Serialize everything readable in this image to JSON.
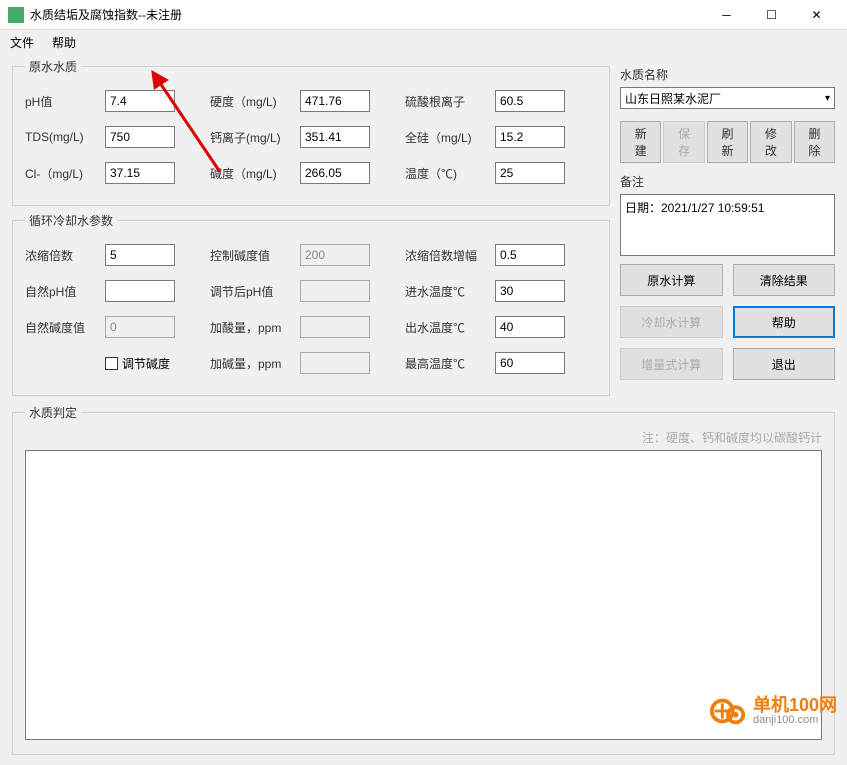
{
  "window": {
    "title": "水质结垢及腐蚀指数--未注册"
  },
  "menu": {
    "file": "文件",
    "help": "帮助"
  },
  "raw": {
    "legend": "原水水质",
    "ph_label": "pH值",
    "ph": "7.4",
    "tds_label": "TDS(mg/L)",
    "tds": "750",
    "cl_label": "Cl-（mg/L)",
    "cl": "37.15",
    "hardness_label": "硬度（mg/L)",
    "hardness": "471.76",
    "ca_label": "钙离子(mg/L)",
    "ca": "351.41",
    "alk_label": "碱度（mg/L)",
    "alk": "266.05",
    "so4_label": "硫酸根离子",
    "so4": "60.5",
    "si_label": "全硅（mg/L)",
    "si": "15.2",
    "temp_label": "温度（℃)",
    "temp": "25"
  },
  "cycle": {
    "legend": "循环冷却水参数",
    "conc_label": "浓缩倍数",
    "conc": "5",
    "natph_label": "自然pH值",
    "natph": "",
    "natalk_label": "自然碱度值",
    "natalk": "0",
    "adjust_check": "调节碱度",
    "ctrlalk_label": "控制碱度值",
    "ctrlalk": "200",
    "adjph_label": "调节后pH值",
    "adjph": "",
    "acid_label": "加酸量，ppm",
    "acid": "",
    "alkadd_label": "加碱量，ppm",
    "alkadd": "",
    "incr_label": "浓缩倍数增幅",
    "incr": "0.5",
    "tin_label": "进水温度℃",
    "tin": "30",
    "tout_label": "出水温度℃",
    "tout": "40",
    "tmax_label": "最高温度℃",
    "tmax": "60"
  },
  "right": {
    "name_label": "水质名称",
    "name_value": "山东日照某水泥厂",
    "btn_new": "新建",
    "btn_save": "保存",
    "btn_refresh": "刷新",
    "btn_modify": "修改",
    "btn_delete": "删除",
    "memo_label": "备注",
    "memo_text": "日期：2021/1/27 10:59:51",
    "btn_rawcalc": "原水计算",
    "btn_clear": "清除结果",
    "btn_coolcalc": "冷却水计算",
    "btn_help": "帮助",
    "btn_inccalc": "增量式计算",
    "btn_exit": "退出"
  },
  "judge": {
    "legend": "水质判定",
    "note": "注：硬度、钙和碱度均以碳酸钙计"
  },
  "watermark": {
    "brand": "单机100网",
    "url": "danji100.com"
  }
}
